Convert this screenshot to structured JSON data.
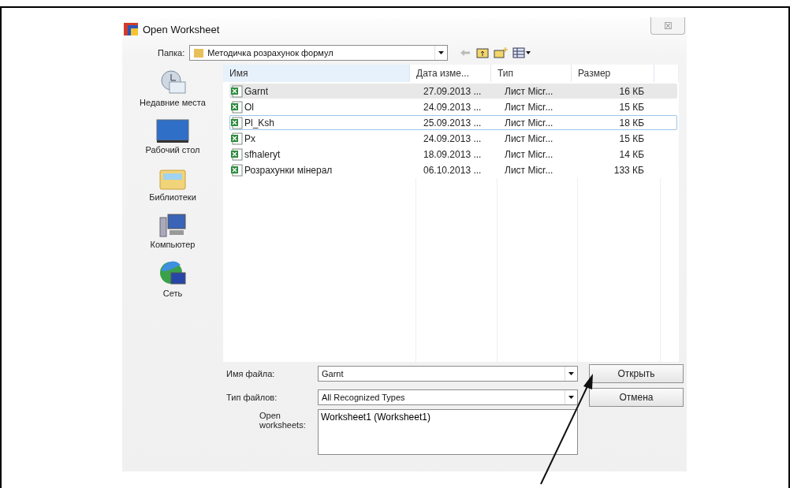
{
  "window": {
    "title": "Open Worksheet",
    "close": "☒"
  },
  "folder_bar": {
    "label": "Папка:",
    "value": "Методичка розрахунок формул"
  },
  "sidebar": {
    "items": [
      {
        "label": "Недавние места",
        "kind": "recent"
      },
      {
        "label": "Рабочий стол",
        "kind": "desktop"
      },
      {
        "label": "Библиотеки",
        "kind": "libraries"
      },
      {
        "label": "Компьютер",
        "kind": "computer"
      },
      {
        "label": "Сеть",
        "kind": "network"
      }
    ]
  },
  "table": {
    "columns": [
      "Имя",
      "Дата изме...",
      "Тип",
      "Размер"
    ],
    "rows": [
      {
        "name": "Garnt",
        "date": "27.09.2013 ...",
        "type": "Лист Micr...",
        "size": "16 КБ",
        "selected": true,
        "focused": false
      },
      {
        "name": "Ol",
        "date": "24.09.2013 ...",
        "type": "Лист Micr...",
        "size": "15 КБ",
        "selected": false,
        "focused": false
      },
      {
        "name": "Pl_Ksh",
        "date": "25.09.2013 ...",
        "type": "Лист Micr...",
        "size": "18 КБ",
        "selected": false,
        "focused": true
      },
      {
        "name": "Px",
        "date": "24.09.2013 ...",
        "type": "Лист Micr...",
        "size": "15 КБ",
        "selected": false,
        "focused": false
      },
      {
        "name": "sfhaleryt",
        "date": "18.09.2013 ...",
        "type": "Лист Micr...",
        "size": "14 КБ",
        "selected": false,
        "focused": false
      },
      {
        "name": "Розрахунки мінерал",
        "date": "06.10.2013 ...",
        "type": "Лист Micr...",
        "size": "133 КБ",
        "selected": false,
        "focused": false
      }
    ]
  },
  "file_name": {
    "label": "Имя файла:",
    "value": "Garnt"
  },
  "file_type": {
    "label": "Тип файлов:",
    "value": "All Recognized Types"
  },
  "open_worksheets": {
    "label": "Open worksheets:",
    "items": [
      "Worksheet1 (Worksheet1)"
    ]
  },
  "buttons": [
    "Открыть",
    "Отмена"
  ]
}
